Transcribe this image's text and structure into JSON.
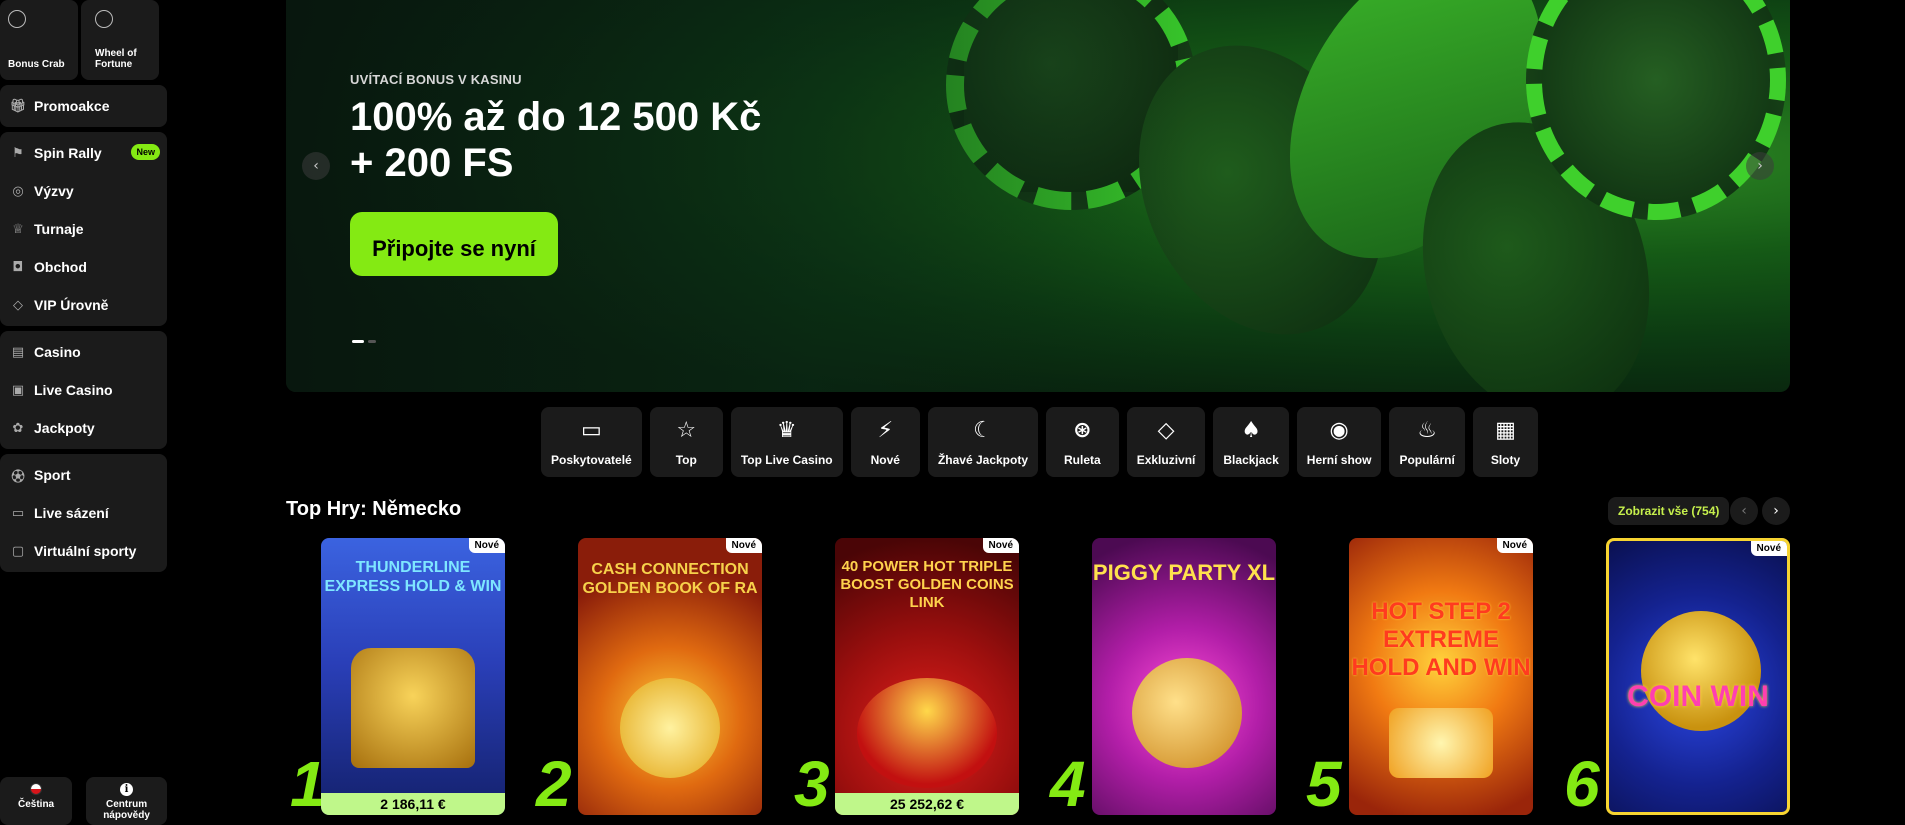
{
  "sidebar": {
    "quick": [
      {
        "label": "Bonus Crab",
        "icon": "crab-icon"
      },
      {
        "label": "Wheel of Fortune",
        "icon": "wheel-icon"
      }
    ],
    "groups": [
      [
        {
          "label": "Promoakce",
          "icon": "gift-icon"
        }
      ],
      [
        {
          "label": "Spin Rally",
          "icon": "flag-icon",
          "badge": "New"
        },
        {
          "label": "Výzvy",
          "icon": "target-icon"
        },
        {
          "label": "Turnaje",
          "icon": "trophy-icon"
        },
        {
          "label": "Obchod",
          "icon": "bag-icon"
        },
        {
          "label": "VIP Úrovně",
          "icon": "diamond-icon"
        }
      ],
      [
        {
          "label": "Casino",
          "icon": "slot-icon"
        },
        {
          "label": "Live Casino",
          "icon": "live-icon"
        },
        {
          "label": "Jackpoty",
          "icon": "jackpot-icon"
        }
      ],
      [
        {
          "label": "Sport",
          "icon": "ball-icon"
        },
        {
          "label": "Live sázení",
          "icon": "live-bet-icon"
        },
        {
          "label": "Virtuální sporty",
          "icon": "virtual-sport-icon"
        }
      ]
    ],
    "language": "Čeština",
    "help": "Centrum nápovědy"
  },
  "hero": {
    "eyebrow": "UVÍTACÍ BONUS V KASINU",
    "title_line1": "100% až do 12 500 Kč",
    "title_line2": "+ 200 FS",
    "cta": "Připojte se nyní"
  },
  "categories": [
    {
      "label": "Poskytovatelé",
      "glyph": "▭"
    },
    {
      "label": "Top",
      "glyph": "☆"
    },
    {
      "label": "Top Live Casino",
      "glyph": "♛"
    },
    {
      "label": "Nové",
      "glyph": "⚡"
    },
    {
      "label": "Žhavé Jackpoty",
      "glyph": "☾"
    },
    {
      "label": "Ruleta",
      "glyph": "⊛"
    },
    {
      "label": "Exkluzivní",
      "glyph": "◇"
    },
    {
      "label": "Blackjack",
      "glyph": "♠"
    },
    {
      "label": "Herní show",
      "glyph": "◉"
    },
    {
      "label": "Populární",
      "glyph": "♨"
    },
    {
      "label": "Sloty",
      "glyph": "▦"
    }
  ],
  "top_games": {
    "title": "Top Hry: Německo",
    "view_all": "Zobrazit vše (754)",
    "games": [
      {
        "rank": "1",
        "name": "Thunderline Express Hold & Win",
        "badge": "Nové",
        "jackpot": "2 186,11 €",
        "bg": "#2a3fb8",
        "accent": "#f2c230"
      },
      {
        "rank": "2",
        "name": "Cash Connection Golden Book of Ra",
        "badge": "Nové",
        "jackpot": "",
        "bg": "#8a1d0a",
        "accent": "#f7b21b"
      },
      {
        "rank": "3",
        "name": "40 Power Hot Triple Boost Golden Coins Link",
        "badge": "Nové",
        "jackpot": "25 252,62 €",
        "bg": "#7a0b0b",
        "accent": "#f4c12b"
      },
      {
        "rank": "4",
        "name": "Piggy Party XL",
        "badge": "",
        "jackpot": "",
        "bg": "#9a1aa0",
        "accent": "#f0b13a"
      },
      {
        "rank": "5",
        "name": "Hot Step 2 Extreme Hold and Win",
        "badge": "Nové",
        "jackpot": "",
        "bg": "#d3420f",
        "accent": "#f9d93a"
      },
      {
        "rank": "6",
        "name": "Coin Win",
        "badge": "Nové",
        "jackpot": "",
        "bg": "#14228f",
        "accent": "#f7c531"
      }
    ]
  },
  "colors": {
    "accent": "#84ea13",
    "panel": "#1b1b1b",
    "jackpot_bg": "#bff78a"
  }
}
